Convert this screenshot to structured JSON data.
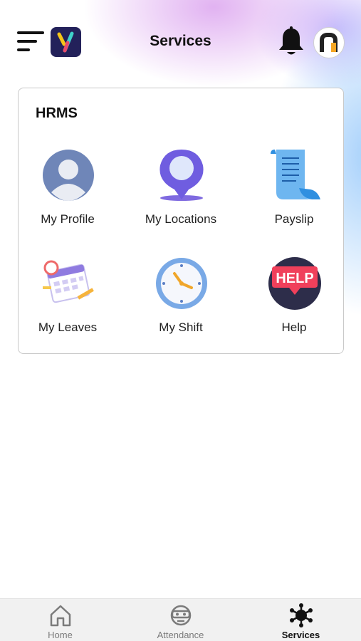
{
  "header": {
    "title": "Services",
    "menu_icon": "hamburger-menu-icon",
    "app_logo": "app-logo",
    "notification_icon": "bell-icon",
    "profile_avatar": "n-logo-avatar"
  },
  "card": {
    "title": "HRMS",
    "items": [
      {
        "label": "My Profile",
        "icon": "profile-icon"
      },
      {
        "label": "My Locations",
        "icon": "location-pin-icon"
      },
      {
        "label": "Payslip",
        "icon": "receipt-icon"
      },
      {
        "label": "My Leaves",
        "icon": "calendar-icon"
      },
      {
        "label": "My Shift",
        "icon": "clock-icon"
      },
      {
        "label": "Help",
        "icon": "help-bubble-icon"
      }
    ]
  },
  "bottom_nav": {
    "items": [
      {
        "label": "Home",
        "icon": "home-icon",
        "active": false
      },
      {
        "label": "Attendance",
        "icon": "attendance-icon",
        "active": false
      },
      {
        "label": "Services",
        "icon": "services-icon",
        "active": true
      }
    ]
  },
  "colors": {
    "accent": "#111111",
    "nav_inactive": "#7b7b7b",
    "logo_bg": "#23215a",
    "help_red": "#f0405b"
  }
}
